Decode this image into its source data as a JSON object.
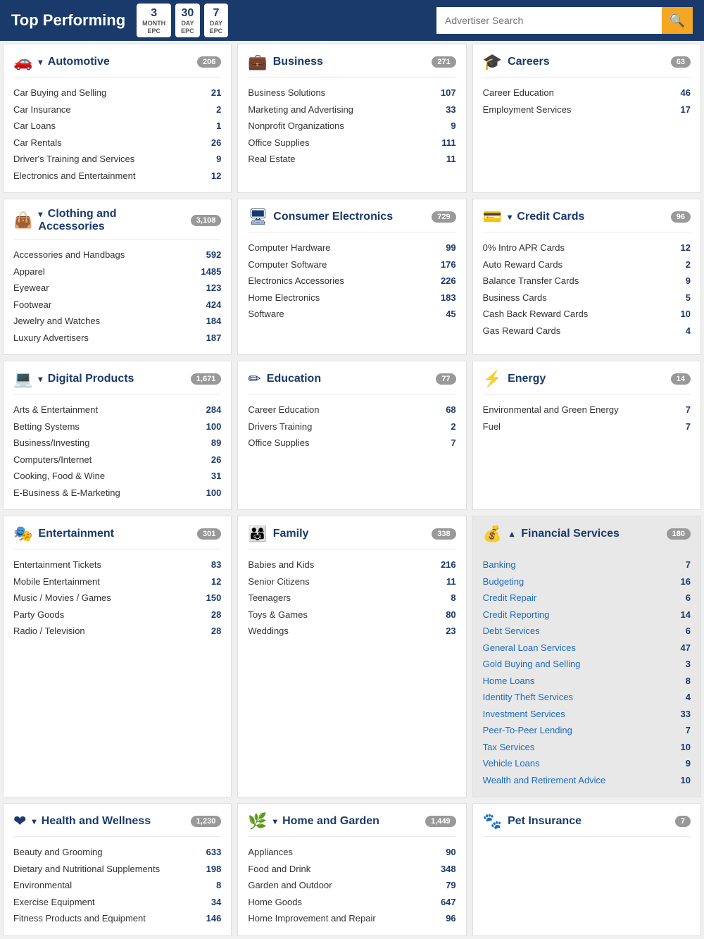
{
  "header": {
    "title": "Top Performing",
    "epc_buttons": [
      {
        "num": "3",
        "label": "MONTH EPC"
      },
      {
        "num": "30",
        "label": "DAY EPC"
      },
      {
        "num": "7",
        "label": "DAY EPC"
      }
    ],
    "search_placeholder": "Advertiser Search"
  },
  "categories": [
    {
      "id": "automotive",
      "icon": "🚗",
      "title": "Automotive",
      "arrow": "▾",
      "count": "206",
      "items": [
        {
          "name": "Car Buying and Selling",
          "num": "21"
        },
        {
          "name": "Car Insurance",
          "num": "2"
        },
        {
          "name": "Car Loans",
          "num": "1"
        },
        {
          "name": "Car Rentals",
          "num": "26"
        },
        {
          "name": "Driver's Training and Services",
          "num": "9"
        },
        {
          "name": "Electronics and Entertainment",
          "num": "12"
        }
      ]
    },
    {
      "id": "business",
      "icon": "💼",
      "title": "Business",
      "arrow": "",
      "count": "271",
      "items": [
        {
          "name": "Business Solutions",
          "num": "107"
        },
        {
          "name": "Marketing and Advertising",
          "num": "33"
        },
        {
          "name": "Nonprofit Organizations",
          "num": "9"
        },
        {
          "name": "Office Supplies",
          "num": "111"
        },
        {
          "name": "Real Estate",
          "num": "11"
        }
      ]
    },
    {
      "id": "careers",
      "icon": "🎓",
      "title": "Careers",
      "arrow": "",
      "count": "63",
      "items": [
        {
          "name": "Career Education",
          "num": "46"
        },
        {
          "name": "Employment Services",
          "num": "17"
        }
      ]
    },
    {
      "id": "clothing",
      "icon": "👜",
      "title": "Clothing and Accessories",
      "arrow": "▾",
      "count": "3,108",
      "items": [
        {
          "name": "Accessories and Handbags",
          "num": "592"
        },
        {
          "name": "Apparel",
          "num": "1485"
        },
        {
          "name": "Eyewear",
          "num": "123"
        },
        {
          "name": "Footwear",
          "num": "424"
        },
        {
          "name": "Jewelry and Watches",
          "num": "184"
        },
        {
          "name": "Luxury Advertisers",
          "num": "187"
        }
      ]
    },
    {
      "id": "consumer-electronics",
      "icon": "🖥",
      "title": "Consumer Electronics",
      "arrow": "",
      "count": "729",
      "items": [
        {
          "name": "Computer Hardware",
          "num": "99"
        },
        {
          "name": "Computer Software",
          "num": "176"
        },
        {
          "name": "Electronics Accessories",
          "num": "226"
        },
        {
          "name": "Home Electronics",
          "num": "183"
        },
        {
          "name": "Software",
          "num": "45"
        }
      ]
    },
    {
      "id": "credit-cards",
      "icon": "💳",
      "title": "Credit Cards",
      "arrow": "▾",
      "count": "96",
      "items": [
        {
          "name": "0% Intro APR Cards",
          "num": "12"
        },
        {
          "name": "Auto Reward Cards",
          "num": "2"
        },
        {
          "name": "Balance Transfer Cards",
          "num": "9"
        },
        {
          "name": "Business Cards",
          "num": "5"
        },
        {
          "name": "Cash Back Reward Cards",
          "num": "10"
        },
        {
          "name": "Gas Reward Cards",
          "num": "4"
        }
      ]
    },
    {
      "id": "digital-products",
      "icon": "💻",
      "title": "Digital Products",
      "arrow": "▾",
      "count": "1,671",
      "items": [
        {
          "name": "Arts & Entertainment",
          "num": "284"
        },
        {
          "name": "Betting Systems",
          "num": "100"
        },
        {
          "name": "Business/Investing",
          "num": "89"
        },
        {
          "name": "Computers/Internet",
          "num": "26"
        },
        {
          "name": "Cooking, Food & Wine",
          "num": "31"
        },
        {
          "name": "E-Business & E-Marketing",
          "num": "100"
        }
      ]
    },
    {
      "id": "education",
      "icon": "✏",
      "title": "Education",
      "arrow": "",
      "count": "77",
      "items": [
        {
          "name": "Career Education",
          "num": "68"
        },
        {
          "name": "Drivers Training",
          "num": "2"
        },
        {
          "name": "Office Supplies",
          "num": "7"
        }
      ]
    },
    {
      "id": "energy",
      "icon": "⚡",
      "title": "Energy",
      "arrow": "",
      "count": "14",
      "items": [
        {
          "name": "Environmental and Green Energy",
          "num": "7"
        },
        {
          "name": "Fuel",
          "num": "7"
        }
      ]
    },
    {
      "id": "entertainment",
      "icon": "🎭",
      "title": "Entertainment",
      "arrow": "",
      "count": "301",
      "items": [
        {
          "name": "Entertainment Tickets",
          "num": "83"
        },
        {
          "name": "Mobile Entertainment",
          "num": "12"
        },
        {
          "name": "Music / Movies / Games",
          "num": "150"
        },
        {
          "name": "Party Goods",
          "num": "28"
        },
        {
          "name": "Radio / Television",
          "num": "28"
        }
      ]
    },
    {
      "id": "family",
      "icon": "👨‍👩‍👧",
      "title": "Family",
      "arrow": "",
      "count": "338",
      "items": [
        {
          "name": "Babies and Kids",
          "num": "216"
        },
        {
          "name": "Senior Citizens",
          "num": "11"
        },
        {
          "name": "Teenagers",
          "num": "8"
        },
        {
          "name": "Toys & Games",
          "num": "80"
        },
        {
          "name": "Weddings",
          "num": "23"
        }
      ]
    },
    {
      "id": "financial-services",
      "icon": "💰",
      "title": "Financial Services",
      "arrow": "▲",
      "count": "180",
      "special": true,
      "items": [
        {
          "name": "Banking",
          "num": "7"
        },
        {
          "name": "Budgeting",
          "num": "16"
        },
        {
          "name": "Credit Repair",
          "num": "6"
        },
        {
          "name": "Credit Reporting",
          "num": "14"
        },
        {
          "name": "Debt Services",
          "num": "6"
        },
        {
          "name": "General Loan Services",
          "num": "47"
        },
        {
          "name": "Gold Buying and Selling",
          "num": "3"
        },
        {
          "name": "Home Loans",
          "num": "8"
        },
        {
          "name": "Identity Theft Services",
          "num": "4"
        },
        {
          "name": "Investment Services",
          "num": "33"
        },
        {
          "name": "Peer-To-Peer Lending",
          "num": "7"
        },
        {
          "name": "Tax Services",
          "num": "10"
        },
        {
          "name": "Vehicle Loans",
          "num": "9"
        },
        {
          "name": "Wealth and Retirement Advice",
          "num": "10"
        }
      ]
    },
    {
      "id": "health-wellness",
      "icon": "❤",
      "title": "Health and Wellness",
      "arrow": "▾",
      "count": "1,230",
      "items": [
        {
          "name": "Beauty and Grooming",
          "num": "633"
        },
        {
          "name": "Dietary and Nutritional Supplements",
          "num": "198"
        },
        {
          "name": "Environmental",
          "num": "8"
        },
        {
          "name": "Exercise Equipment",
          "num": "34"
        },
        {
          "name": "Fitness Products and Equipment",
          "num": "146"
        }
      ]
    },
    {
      "id": "home-garden",
      "icon": "🌿",
      "title": "Home and Garden",
      "arrow": "▾",
      "count": "1,449",
      "items": [
        {
          "name": "Appliances",
          "num": "90"
        },
        {
          "name": "Food and Drink",
          "num": "348"
        },
        {
          "name": "Garden and Outdoor",
          "num": "79"
        },
        {
          "name": "Home Goods",
          "num": "647"
        },
        {
          "name": "Home Improvement and Repair",
          "num": "96"
        }
      ]
    },
    {
      "id": "pet-insurance",
      "icon": "🐾",
      "title": "Pet Insurance",
      "arrow": "",
      "count": "7",
      "items": []
    }
  ]
}
